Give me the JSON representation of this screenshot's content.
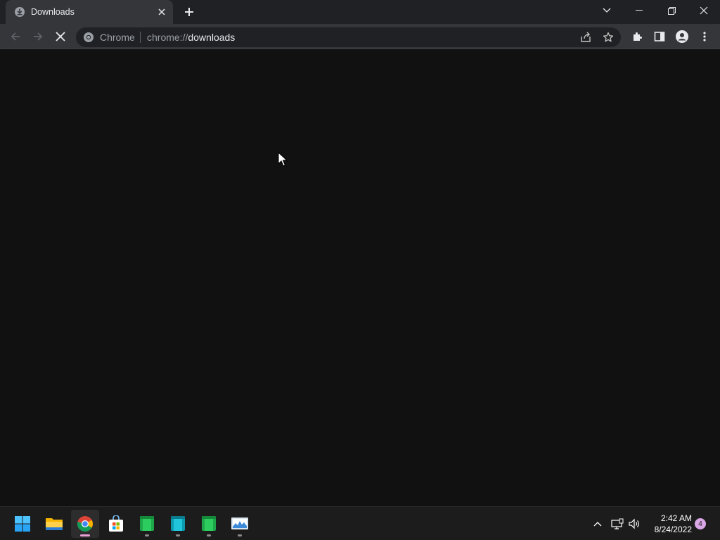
{
  "tab": {
    "title": "Downloads"
  },
  "omnibox": {
    "chip": "Chrome",
    "scheme": "chrome://",
    "host": "downloads"
  },
  "clock": {
    "time": "2:42 AM",
    "date": "8/24/2022"
  },
  "notifications": {
    "count": "4"
  },
  "colors": {
    "titlebar": "#202124",
    "toolbar": "#35363a",
    "content": "#111111",
    "taskbar": "#1c1c1c",
    "accent": "#e8a0d8"
  },
  "icons": {
    "tab": [
      "downloads-favicon-icon",
      "close-icon",
      "plus-icon"
    ],
    "window": [
      "chevron-down-icon",
      "minimize-icon",
      "restore-icon",
      "close-icon"
    ],
    "toolbar": [
      "back-arrow-icon",
      "forward-arrow-icon",
      "stop-loading-icon",
      "chrome-logo-icon",
      "share-icon",
      "star-icon",
      "extensions-icon",
      "side-panel-icon",
      "profile-icon",
      "more-vert-icon"
    ],
    "taskbar": [
      "windows-start-icon",
      "file-explorer-icon",
      "chrome-icon",
      "microsoft-store-icon",
      "green-app-icon",
      "teal-app-icon",
      "green-app-icon",
      "monitor-app-icon"
    ],
    "tray": [
      "chevron-up-icon",
      "network-icon",
      "volume-icon"
    ]
  }
}
